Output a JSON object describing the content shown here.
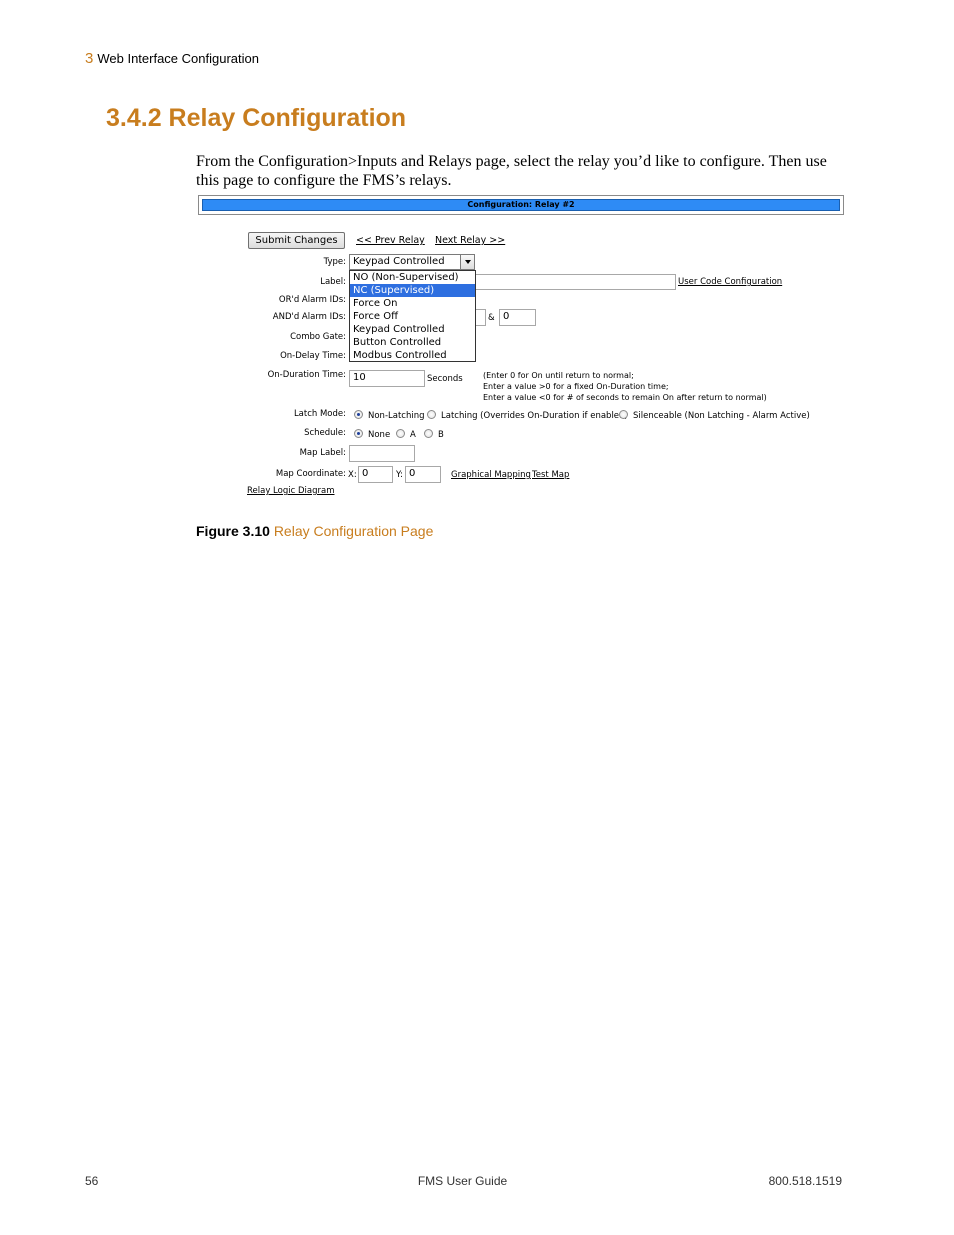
{
  "header": {
    "chapter_number": "3",
    "chapter_title": "Web Interface Configuration"
  },
  "section_title": "3.4.2 Relay Configuration",
  "intro": "From the Configuration>Inputs and Relays page, select the relay you’d like to configure. Then use this page to configure the FMS’s relays.",
  "screenshot": {
    "bar_title": "Configuration: Relay #2",
    "submit_label": "Submit Changes",
    "prev_link": "<< Prev Relay",
    "next_link": "Next Relay >>",
    "type_label": "Type:",
    "type_value": "Keypad Controlled",
    "type_options": [
      "NO (Non-Supervised)",
      "NC (Supervised)",
      "Force On",
      "Force Off",
      "Keypad Controlled",
      "Button Controlled",
      "Modbus Controlled"
    ],
    "type_highlighted": "NC (Supervised)",
    "label_label": "Label:",
    "user_code_link": "User Code Configuration",
    "ord_label": "OR'd Alarm IDs:",
    "andd_label": "AND'd Alarm IDs:",
    "andd_sep": "&",
    "andd_value": "0",
    "combo_label": "Combo Gate:",
    "ondelay_label": "On-Delay Time:",
    "onduration_label": "On-Duration Time:",
    "onduration_value": "10",
    "seconds_label": "Seconds",
    "hint_lines": [
      "(Enter 0 for On until return to normal;",
      "Enter a value >0 for a fixed On-Duration time;",
      "Enter a value <0 for # of seconds to remain On after return to normal)"
    ],
    "latch_label": "Latch Mode:",
    "latch_options": [
      "Non-Latching",
      "Latching (Overrides On-Duration if enabled)",
      "Silenceable (Non Latching - Alarm Active)"
    ],
    "schedule_label": "Schedule:",
    "schedule_options": [
      "None",
      "A",
      "B"
    ],
    "maplabel_label": "Map Label:",
    "mapcoord_label": "Map Coordinate:",
    "x_label": "X:",
    "x_value": "0",
    "y_label": "Y:",
    "y_value": "0",
    "graphical_link": "Graphical Mapping",
    "testmap_link": "Test Map",
    "logic_link": "Relay Logic Diagram"
  },
  "caption": {
    "number": "Figure 3.10",
    "text": "Relay Configuration Page"
  },
  "footer": {
    "page": "56",
    "center": "FMS User Guide",
    "phone": "800.518.1519"
  }
}
